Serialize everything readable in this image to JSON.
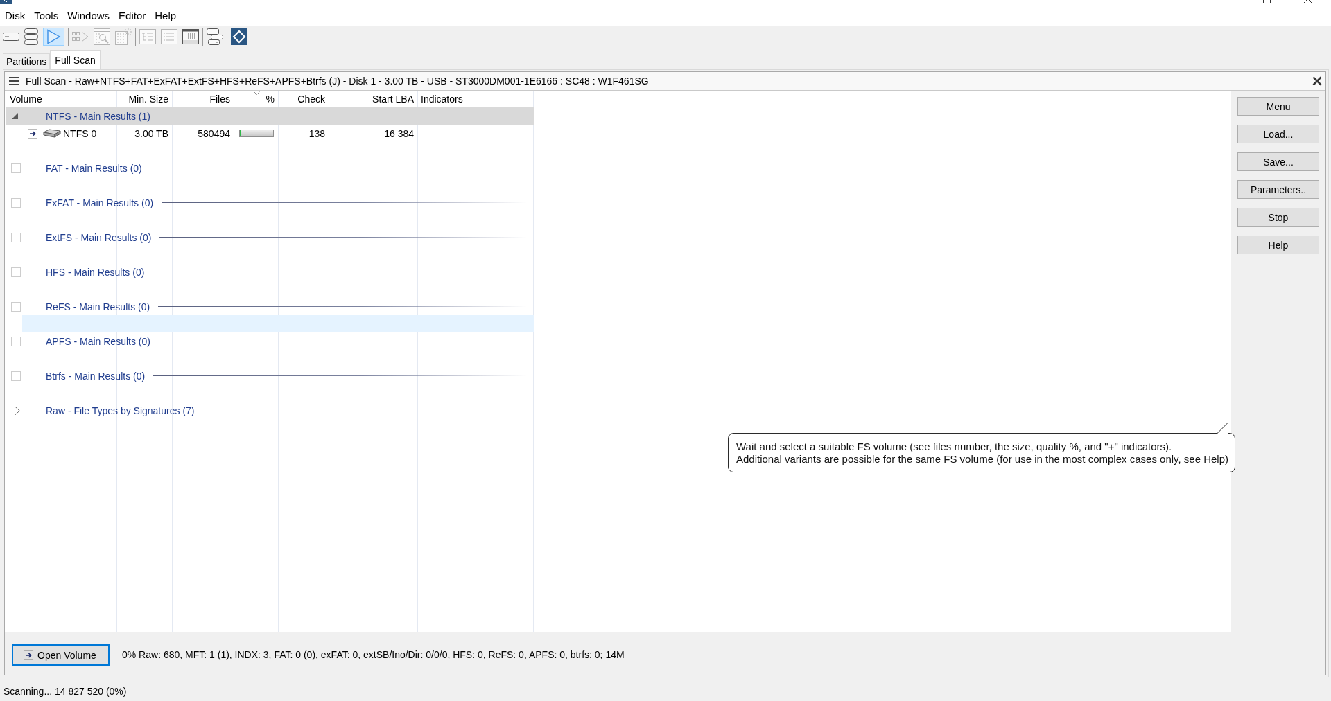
{
  "menu": [
    {
      "label": "Disk"
    },
    {
      "label": "Tools"
    },
    {
      "label": "Windows"
    },
    {
      "label": "Editor"
    },
    {
      "label": "Help"
    }
  ],
  "toolbar": [
    [
      {
        "kind": "drive",
        "selected": false,
        "disabled": false
      },
      {
        "kind": "disks",
        "selected": false,
        "disabled": false
      },
      {
        "kind": "play",
        "selected": true,
        "disabled": false
      }
    ],
    [
      {
        "kind": "step",
        "selected": false,
        "disabled": true
      },
      {
        "kind": "doc_search",
        "selected": false,
        "disabled": true
      },
      {
        "kind": "doc_sparkle",
        "selected": false,
        "disabled": true
      }
    ],
    [
      {
        "kind": "tree",
        "selected": false,
        "disabled": true
      },
      {
        "kind": "list",
        "selected": false,
        "disabled": true
      },
      {
        "kind": "grid",
        "selected": false,
        "disabled": false
      }
    ],
    [
      {
        "kind": "windows",
        "selected": false,
        "disabled": false
      }
    ],
    [
      {
        "kind": "logo",
        "selected": false,
        "disabled": false
      }
    ]
  ],
  "tabs": [
    {
      "label": "Partitions",
      "selected": false
    },
    {
      "label": "Full Scan",
      "selected": true
    }
  ],
  "panel": {
    "title": "Full Scan - Raw+NTFS+FAT+ExFAT+ExtFS+HFS+ReFS+APFS+Btrfs (J) - Disk 1 - 3.00 TB - USB - ST3000DM001-1E6166 : SC48 : W1F461SG",
    "columns": [
      {
        "label": "Volume",
        "sorted": false
      },
      {
        "label": "Min. Size",
        "sorted": false
      },
      {
        "label": "Files",
        "sorted": false
      },
      {
        "label": "%",
        "sorted": true
      },
      {
        "label": "Check",
        "sorted": false
      },
      {
        "label": "Start LBA",
        "sorted": false
      },
      {
        "label": "Indicators",
        "sorted": false
      }
    ],
    "rows": [
      {
        "kind": "group",
        "label": "NTFS - Main Results (1)",
        "expanded": true,
        "selected": true,
        "hovered": false
      },
      {
        "kind": "volume",
        "name": "NTFS 0",
        "min_size": "3.00 TB",
        "files": "580494",
        "level": 0.05,
        "check": "138",
        "start_lba": "16 384",
        "selected": false,
        "hovered": false
      },
      {
        "kind": "blank",
        "selected": false,
        "hovered": false
      },
      {
        "kind": "empty_group",
        "label": "FAT - Main Results (0)",
        "selected": false,
        "hovered": false
      },
      {
        "kind": "blank",
        "selected": false,
        "hovered": false
      },
      {
        "kind": "empty_group",
        "label": "ExFAT - Main Results (0)",
        "selected": false,
        "hovered": false
      },
      {
        "kind": "blank",
        "selected": false,
        "hovered": false
      },
      {
        "kind": "empty_group",
        "label": "ExtFS - Main Results (0)",
        "selected": false,
        "hovered": false
      },
      {
        "kind": "blank",
        "selected": false,
        "hovered": false
      },
      {
        "kind": "empty_group",
        "label": "HFS - Main Results (0)",
        "selected": false,
        "hovered": false
      },
      {
        "kind": "blank",
        "selected": false,
        "hovered": false
      },
      {
        "kind": "empty_group",
        "label": "ReFS - Main Results (0)",
        "selected": false,
        "hovered": false
      },
      {
        "kind": "blank",
        "selected": false,
        "hovered": true
      },
      {
        "kind": "empty_group",
        "label": "APFS - Main Results (0)",
        "selected": false,
        "hovered": false
      },
      {
        "kind": "blank",
        "selected": false,
        "hovered": false
      },
      {
        "kind": "empty_group",
        "label": "Btrfs - Main Results (0)",
        "selected": false,
        "hovered": false
      },
      {
        "kind": "blank",
        "selected": false,
        "hovered": false
      },
      {
        "kind": "group",
        "label": "Raw - File Types by Signatures (7)",
        "expanded": false,
        "selected": false,
        "hovered": false
      }
    ],
    "side_buttons": [
      {
        "label": "Menu"
      },
      {
        "label": "Load..."
      },
      {
        "label": "Save..."
      },
      {
        "label": "Parameters.."
      },
      {
        "label": "Stop"
      },
      {
        "label": "Help"
      }
    ],
    "hint": {
      "lines": [
        "Wait and select a suitable FS volume (see files number, the size, quality %, and \"+\" indicators).",
        "Additional variants are possible for the same FS volume (for use in the most complex cases only, see Help)"
      ]
    },
    "open_button": {
      "label": "Open Volume"
    },
    "summary": "0% Raw: 680, MFT: 1 (1), INDX: 3, FAT: 0 (0), exFAT: 0, extSB/Ino/Dir: 0/0/0, HFS: 0, ReFS: 0, APFS: 0, btrfs: 0; 14M"
  },
  "status_bar": {
    "text": "Scanning... 14 827 520 (0%)"
  }
}
